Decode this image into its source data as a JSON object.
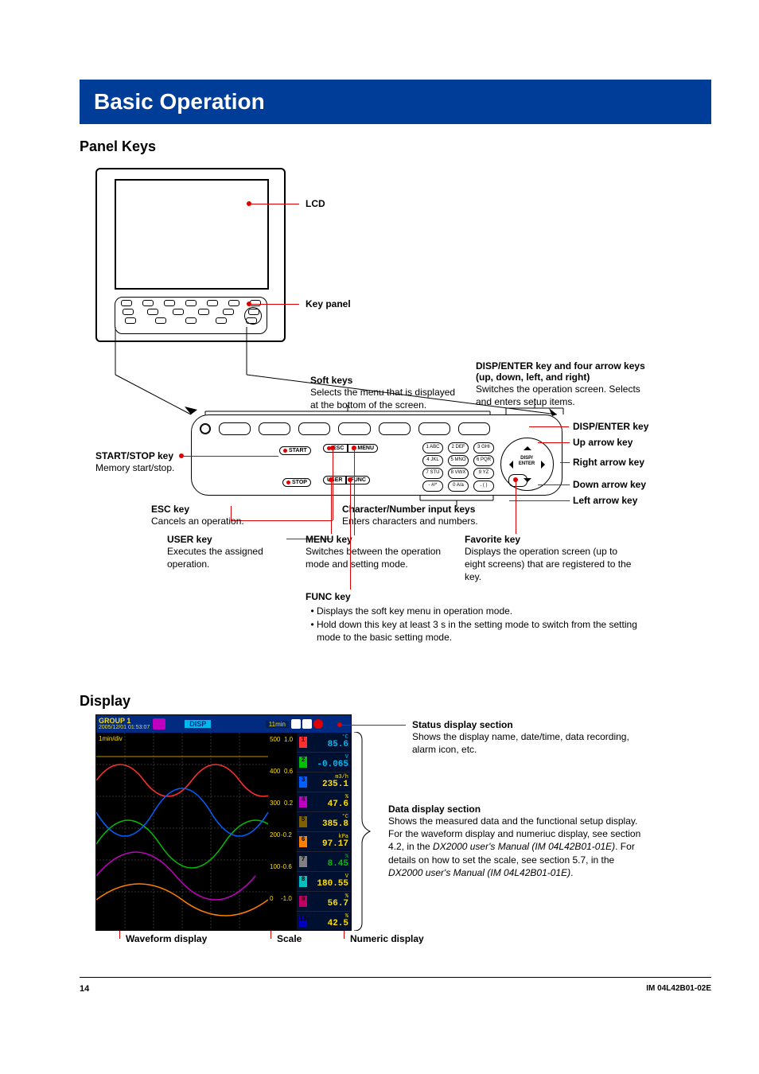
{
  "title": "Basic Operation",
  "sections": {
    "panel_keys": "Panel Keys",
    "display": "Display"
  },
  "panel": {
    "lcd": "LCD",
    "key_panel": "Key panel",
    "soft_keys": {
      "title": "Soft keys",
      "desc": "Selects the menu that is displayed at the bottom of the screen."
    },
    "disp_enter_block": {
      "title": "DISP/ENTER key and four arrow keys (up, down, left, and right)",
      "desc": "Switches the operation screen. Selects and enters setup items."
    },
    "disp_enter_key": "DISP/ENTER key",
    "up_arrow": "Up arrow key",
    "right_arrow": "Right arrow key",
    "down_arrow": "Down arrow key",
    "left_arrow": "Left arrow key",
    "start_stop": {
      "title": "START/STOP key",
      "desc": "Memory start/stop."
    },
    "esc": {
      "title": "ESC key",
      "desc": "Cancels an operation."
    },
    "user": {
      "title": "USER key",
      "desc": "Executes the assigned operation."
    },
    "menu": {
      "title": "MENU key",
      "desc": "Switches between the operation mode and setting mode."
    },
    "char_num": {
      "title": "Character/Number input keys",
      "desc": "Enters characters and numbers."
    },
    "favorite": {
      "title": "Favorite key",
      "desc": "Displays the operation screen (up to eight screens) that are registered to the key."
    },
    "func": {
      "title": "FUNC key",
      "b1": "Displays the soft key menu in operation mode.",
      "b2": "Hold down this key at least 3 s in the setting mode to switch from the setting mode to the basic setting mode."
    },
    "keycaps": {
      "start": "START",
      "stop": "STOP",
      "esc": "ESC",
      "menu": "MENU",
      "user": "USER",
      "func": "FUNC",
      "disp": "DISP/",
      "enter": "ENTER",
      "n1": "1 ABC",
      "n2": "2 DEF",
      "n3": "3 GHI",
      "n4": "4 JKL",
      "n5": "5 MNO",
      "n6": "6 PQR",
      "n7": "7 STU",
      "n8": "8 VWX",
      "n9": "9 YZ",
      "nm": "- #/*",
      "n0": "0 A/a",
      "nd": ". ( )"
    }
  },
  "display": {
    "status_title": "Status display section",
    "status_desc": "Shows the display name, date/time, data recording, alarm icon, etc.",
    "data_title": "Data display section",
    "data_desc1": "Shows the measured data and the functional setup display.",
    "data_desc2a": "For the waveform display and numeriuc display, see section 4.2, in the ",
    "data_desc2b": "DX2000 user's Manual (IM 04L42B01-01E)",
    "data_desc2c": ". For details on how to set the scale, see section 5.7, in the ",
    "data_desc2d": "DX2000 user's Manual (IM 04L42B01-01E)",
    "data_desc2e": ".",
    "waveform": "Waveform display",
    "scale": "Scale",
    "numeric": "Numeric display",
    "status_bar": {
      "group": "GROUP 1",
      "datetime": "2005/12/01 01:53:07",
      "mode": "DISP",
      "rate": "11min",
      "div": "1min/div"
    },
    "midscale": [
      "500",
      "400",
      "300",
      "200",
      "100",
      "0",
      "1.0",
      "0.6",
      "0.2",
      "-0.2",
      "-0.6",
      "-1.0",
      "300",
      "200",
      "100"
    ],
    "channels": [
      {
        "n": "1",
        "bg": "#ff3030",
        "unit": "°C",
        "val": "85.6",
        "col": "#00b8f0"
      },
      {
        "n": "2",
        "bg": "#00c000",
        "unit": "V",
        "val": "-0.065",
        "col": "#00b8f0"
      },
      {
        "n": "3",
        "bg": "#0060ff",
        "unit": "m3/h",
        "val": "235.1",
        "col": "#ffde00"
      },
      {
        "n": "4",
        "bg": "#c000c0",
        "unit": "%",
        "val": "47.6",
        "col": "#ffde00"
      },
      {
        "n": "5",
        "bg": "#806000",
        "unit": "°C",
        "val": "385.8",
        "col": "#ffde00"
      },
      {
        "n": "6",
        "bg": "#ff8000",
        "unit": "kPa",
        "val": "97.17",
        "col": "#ffde00"
      },
      {
        "n": "7",
        "bg": "#808080",
        "unit": "%",
        "val": "8.45",
        "col": "#00c000"
      },
      {
        "n": "8",
        "bg": "#00c0c0",
        "unit": "V",
        "val": "180.55",
        "col": "#ffde00"
      },
      {
        "n": "9",
        "bg": "#c00060",
        "unit": "%",
        "val": "56.7",
        "col": "#ffde00"
      },
      {
        "n": "10",
        "bg": "#0000c0",
        "unit": "%",
        "val": "42.5",
        "col": "#ffde00"
      }
    ]
  },
  "footer": {
    "page": "14",
    "doc": "IM 04L42B01-02E"
  }
}
